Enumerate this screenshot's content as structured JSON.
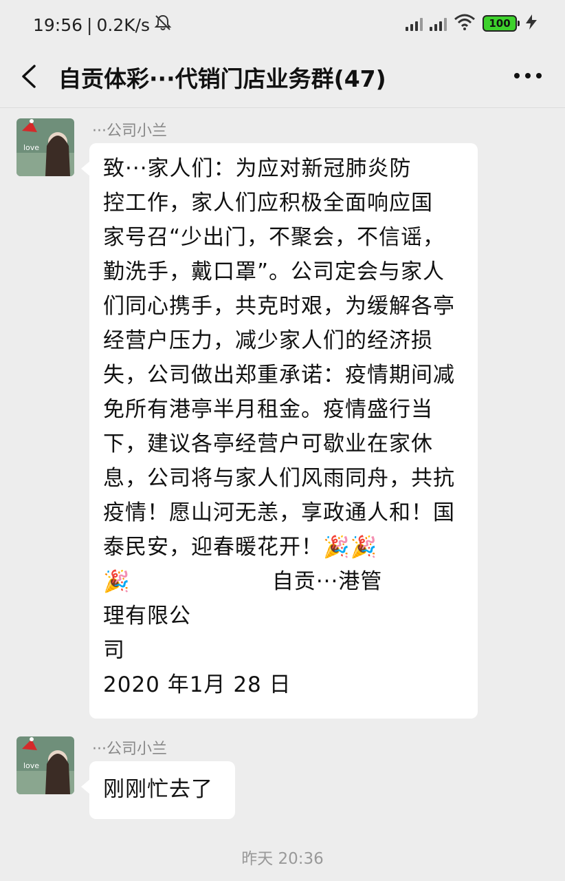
{
  "status_bar": {
    "time": "19:56",
    "separator": "|",
    "net_speed": "0.2K/s",
    "battery_level": "100",
    "icons": [
      "mute-icon",
      "signal-icon",
      "signal-icon",
      "wifi-icon",
      "battery-icon",
      "charging-icon"
    ]
  },
  "header": {
    "title": "自贡体彩···代销门店业务群(47)",
    "back_icon": "back-chevron-icon",
    "more_icon": "more-dots-icon"
  },
  "messages": [
    {
      "sender": "···公司小兰",
      "text": "致···家人们：为应对新冠肺炎防\n控工作，家人们应积极全面响应国\n家号召“少出门，不聚会，不信谣，\n勤洗手，戴口罩”。公司定会与家人\n们同心携手，共克时艰，为缓解各亭\n经营户压力，减少家人们的经济损\n失，公司做出郑重承诺：疫情期间减\n免所有港亭半月租金。疫情盛行当\n下，建议各亭经营户可歇业在家休\n息，公司将与家人们风雨同舟，共抗\n疫情！愿山河无恙，享政通人和！国\n泰民安，迎春暖花开！🎉🎉\n🎉                   自贡···港管\n理有限公\n司\n2020 年1月 28 日"
    },
    {
      "sender": "···公司小兰",
      "text": "刚刚忙去了"
    }
  ],
  "time_divider": "昨天 20:36"
}
